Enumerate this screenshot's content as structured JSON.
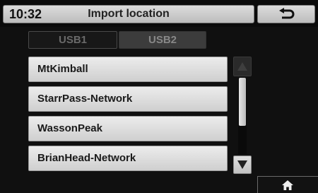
{
  "header": {
    "time": "10:32",
    "title": "Import location",
    "back_icon": "back-arrow-icon"
  },
  "tabs": [
    {
      "label": "USB1",
      "selected": true
    },
    {
      "label": "USB2",
      "selected": false
    }
  ],
  "list": {
    "items": [
      {
        "label": "MtKimball"
      },
      {
        "label": "StarrPass-Network"
      },
      {
        "label": "WassonPeak"
      },
      {
        "label": "BrianHead-Network"
      }
    ]
  },
  "scrollbar": {
    "up_icon": "triangle-up-icon",
    "down_icon": "triangle-down-icon",
    "up_enabled": false,
    "down_enabled": true
  },
  "footer": {
    "home_icon": "home-icon"
  },
  "colors": {
    "background": "#101010",
    "button_face": "#d4d4d4",
    "text": "#1a1a1a"
  }
}
